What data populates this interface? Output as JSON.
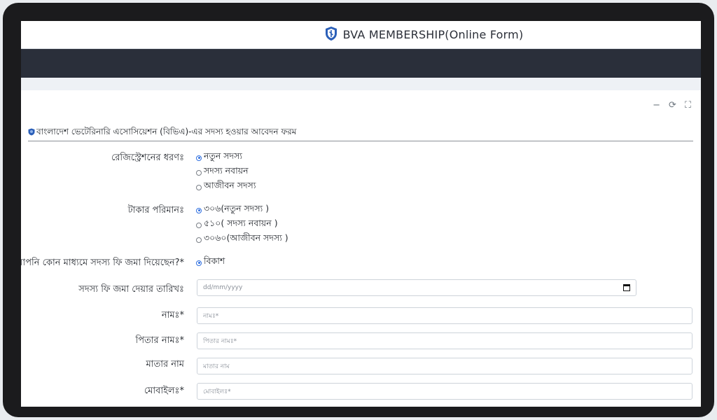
{
  "header": {
    "title": "BVA MEMBERSHIP(Online Form)"
  },
  "card": {
    "title": "বাংলাদেশ ভেটেরিনারি এসোসিয়েশন (বিভিএ)-এর সদস্য হওয়ার আবেদন ফরম",
    "tools": {
      "minimize": "−",
      "refresh": "⟳",
      "expand": "⛶"
    }
  },
  "form": {
    "registration_type": {
      "label": "রেজিস্ট্রেশনের ধরণঃ",
      "options": [
        "নতুন সদস্য",
        "সদস্য নবায়ন",
        "আজীবন সদস্য"
      ],
      "selected": 0
    },
    "amount": {
      "label": "টাকার পরিমানঃ",
      "options": [
        "৩০৬(নতুন সদস্য )",
        "৫১০( সদস্য নবায়ন )",
        "৩০৬০(আজীবন সদস্য )"
      ],
      "selected": 0
    },
    "payment_method": {
      "label": "আপনি কোন মাধ্যমে সদস্য ফি জমা দিয়েছেন?*",
      "options": [
        "বিকাশ"
      ],
      "selected": 0
    },
    "payment_date": {
      "label": "সদস্য ফি জমা দেয়ার তারিখঃ",
      "placeholder": "dd/mm/yyyy"
    },
    "name": {
      "label": "নামঃ*",
      "placeholder": "নামঃ*"
    },
    "father_name": {
      "label": "পিতার নামঃ*",
      "placeholder": "পিতার নামঃ*"
    },
    "mother_name": {
      "label": "মাতার নাম",
      "placeholder": "মাতার নাম"
    },
    "mobile": {
      "label": "মোবাইলঃ*",
      "placeholder": "মোবাইলঃ*"
    }
  },
  "colors": {
    "dark_bar": "#2a2f3a",
    "radio_selected": "#2f6fe0",
    "logo_blue": "#2b5fb8"
  }
}
